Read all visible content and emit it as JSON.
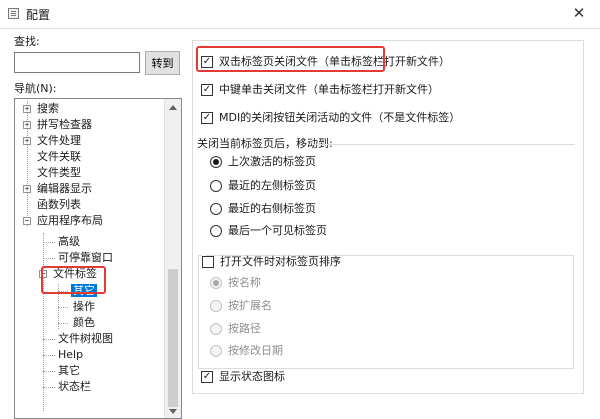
{
  "window": {
    "title": "配置",
    "close_glyph": "✕"
  },
  "search": {
    "label": "查找:",
    "value": "",
    "button_label": "转到"
  },
  "navigation": {
    "label": "导航(N):",
    "items": [
      {
        "label": "搜索"
      },
      {
        "label": "拼写检查器"
      },
      {
        "label": "文件处理"
      },
      {
        "label": "文件关联"
      },
      {
        "label": "文件类型"
      },
      {
        "label": "编辑器显示"
      },
      {
        "label": "函数列表"
      },
      {
        "label": "应用程序布局"
      },
      {
        "label": "高级"
      },
      {
        "label": "可停靠窗口"
      },
      {
        "label": "文件标签"
      },
      {
        "label": "其它"
      },
      {
        "label": "操作"
      },
      {
        "label": "颜色"
      },
      {
        "label": "文件树视图"
      },
      {
        "label": "Help"
      },
      {
        "label": "其它"
      },
      {
        "label": "状态栏"
      }
    ],
    "selected_label": "其它"
  },
  "settings": {
    "checkboxes_top": [
      {
        "label": "双击标签页关闭文件（单击标签栏打开新文件）",
        "checked": true
      },
      {
        "label": "中键单击关闭文件（单击标签栏打开新文件）",
        "checked": true
      },
      {
        "label": "MDI的关闭按钮关闭活动的文件（不是文件标签）",
        "checked": true
      }
    ],
    "after_close_label": "关闭当前标签页后，移动到:",
    "after_close_options": [
      {
        "label": "上次激活的标签页",
        "selected": true
      },
      {
        "label": "最近的左侧标签页",
        "selected": false
      },
      {
        "label": "最近的右侧标签页",
        "selected": false
      },
      {
        "label": "最后一个可见标签页",
        "selected": false
      }
    ],
    "sort_checkbox": {
      "label": "打开文件时对标签页排序",
      "checked": false
    },
    "sort_options": [
      {
        "label": "按名称",
        "selected": true
      },
      {
        "label": "按扩展名",
        "selected": false
      },
      {
        "label": "按路径",
        "selected": false
      },
      {
        "label": "按修改日期",
        "selected": false
      }
    ],
    "status_icon": {
      "label": "显示状态图标",
      "checked": true
    }
  },
  "colors": {
    "highlight": "#e53935",
    "selection": "#0078d7"
  }
}
